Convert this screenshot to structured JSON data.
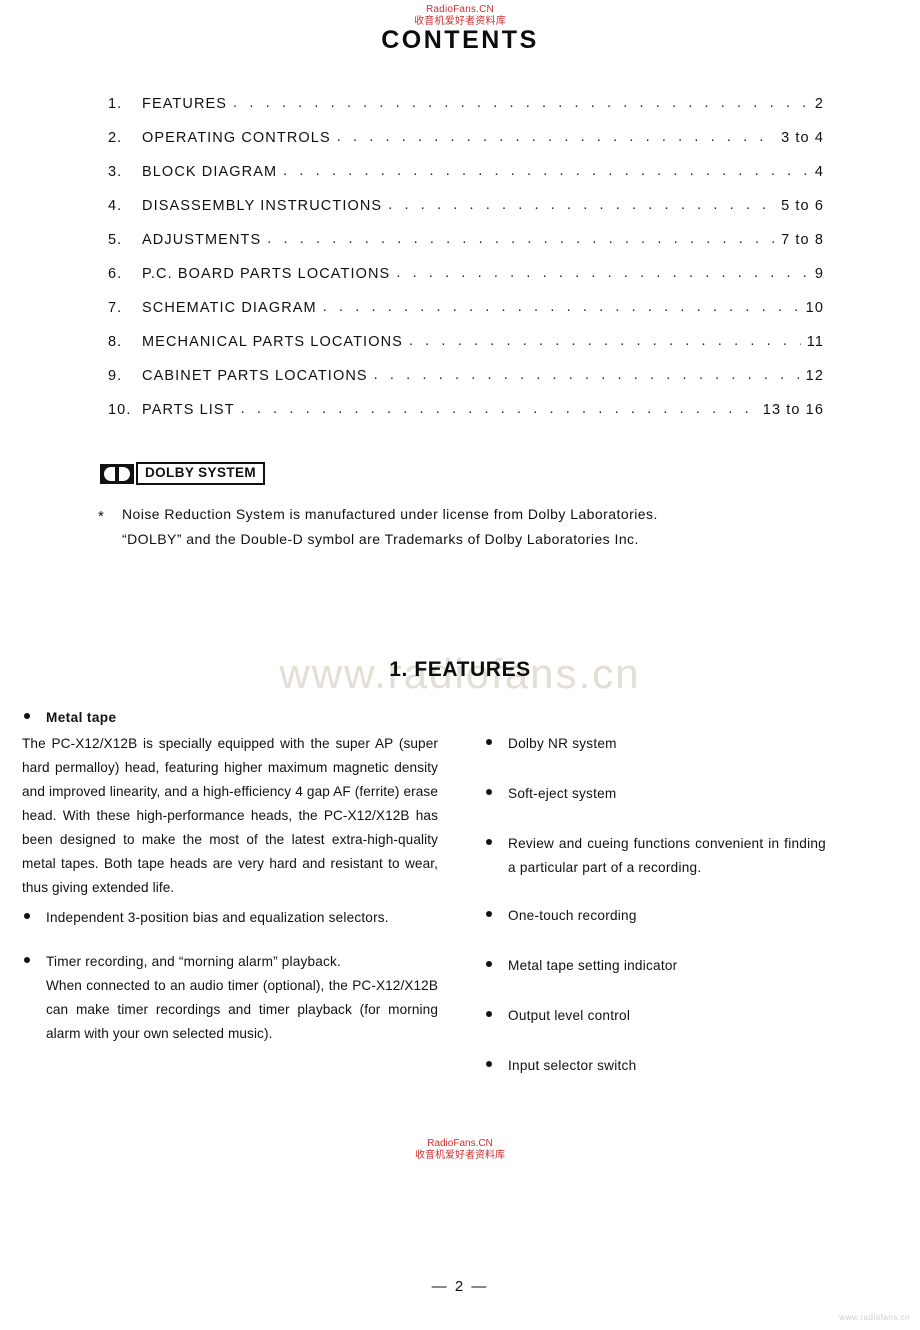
{
  "watermarks": {
    "top_line1": "RadioFans.CN",
    "top_line2": "收音机爱好者资料库",
    "bottom_line1": "RadioFans.CN",
    "bottom_line2": "收音机爱好者资料库",
    "big": "www.radiofans.cn",
    "corner": "www.radiofans.cn"
  },
  "contents": {
    "title": "CONTENTS",
    "items": [
      {
        "num": "1.",
        "label": "FEATURES",
        "page": "2"
      },
      {
        "num": "2.",
        "label": "OPERATING CONTROLS",
        "page": "3 to 4"
      },
      {
        "num": "3.",
        "label": "BLOCK DIAGRAM",
        "page": "4"
      },
      {
        "num": "4.",
        "label": "DISASSEMBLY INSTRUCTIONS",
        "page": "5 to 6"
      },
      {
        "num": "5.",
        "label": "ADJUSTMENTS",
        "page": "7 to 8"
      },
      {
        "num": "6.",
        "label": "P.C. BOARD PARTS LOCATIONS",
        "page": "9"
      },
      {
        "num": "7.",
        "label": "SCHEMATIC DIAGRAM",
        "page": "10"
      },
      {
        "num": "8.",
        "label": "MECHANICAL PARTS LOCATIONS",
        "page": "11"
      },
      {
        "num": "9.",
        "label": "CABINET PARTS LOCATIONS",
        "page": "12"
      },
      {
        "num": "10.",
        "label": "PARTS LIST",
        "page": "13 to 16"
      }
    ],
    "leader": ". . . . . . . . . . . . . . . . . . . . . . . . . . . . . . . . . . . . . . . . . . . . . . . . . . . . . . . . . . . . . . . . . . . . . . . . . . . . . . . . ."
  },
  "dolby": {
    "badge_label": "DOLBY SYSTEM",
    "star": "*",
    "note_line1": "Noise Reduction System is manufactured under license from Dolby Laboratories.",
    "note_line2": "“DOLBY” and the Double-D symbol are Trademarks of Dolby Laboratories Inc."
  },
  "features": {
    "heading": "1. FEATURES",
    "left": {
      "metal_tape_head": "Metal tape",
      "metal_tape_body": "The PC-X12/X12B is specially equipped with the super AP (super hard permalloy) head, featuring higher maximum magnetic density and improved linearity, and a high-efficiency 4 gap AF (ferrite) erase head. With these high-performance heads, the PC-X12/X12B has been designed to make the most of the latest extra-high-quality metal tapes. Both tape heads are very hard and resistant to wear, thus giving extended life.",
      "bias_item": "Independent 3-position bias and equalization selectors.",
      "timer_head": "Timer recording, and “morning alarm” playback.",
      "timer_body": "When connected to an audio timer (optional), the PC-X12/X12B can make timer recordings and timer playback (for morning alarm with your own selected music)."
    },
    "right_items": [
      "Dolby NR system",
      "Soft-eject system",
      "Review and cueing functions convenient in finding a particular part of a recording.",
      "One-touch recording",
      "Metal tape setting indicator",
      "Output level control",
      "Input selector switch"
    ]
  },
  "footer": {
    "page_number": "— 2 —"
  }
}
